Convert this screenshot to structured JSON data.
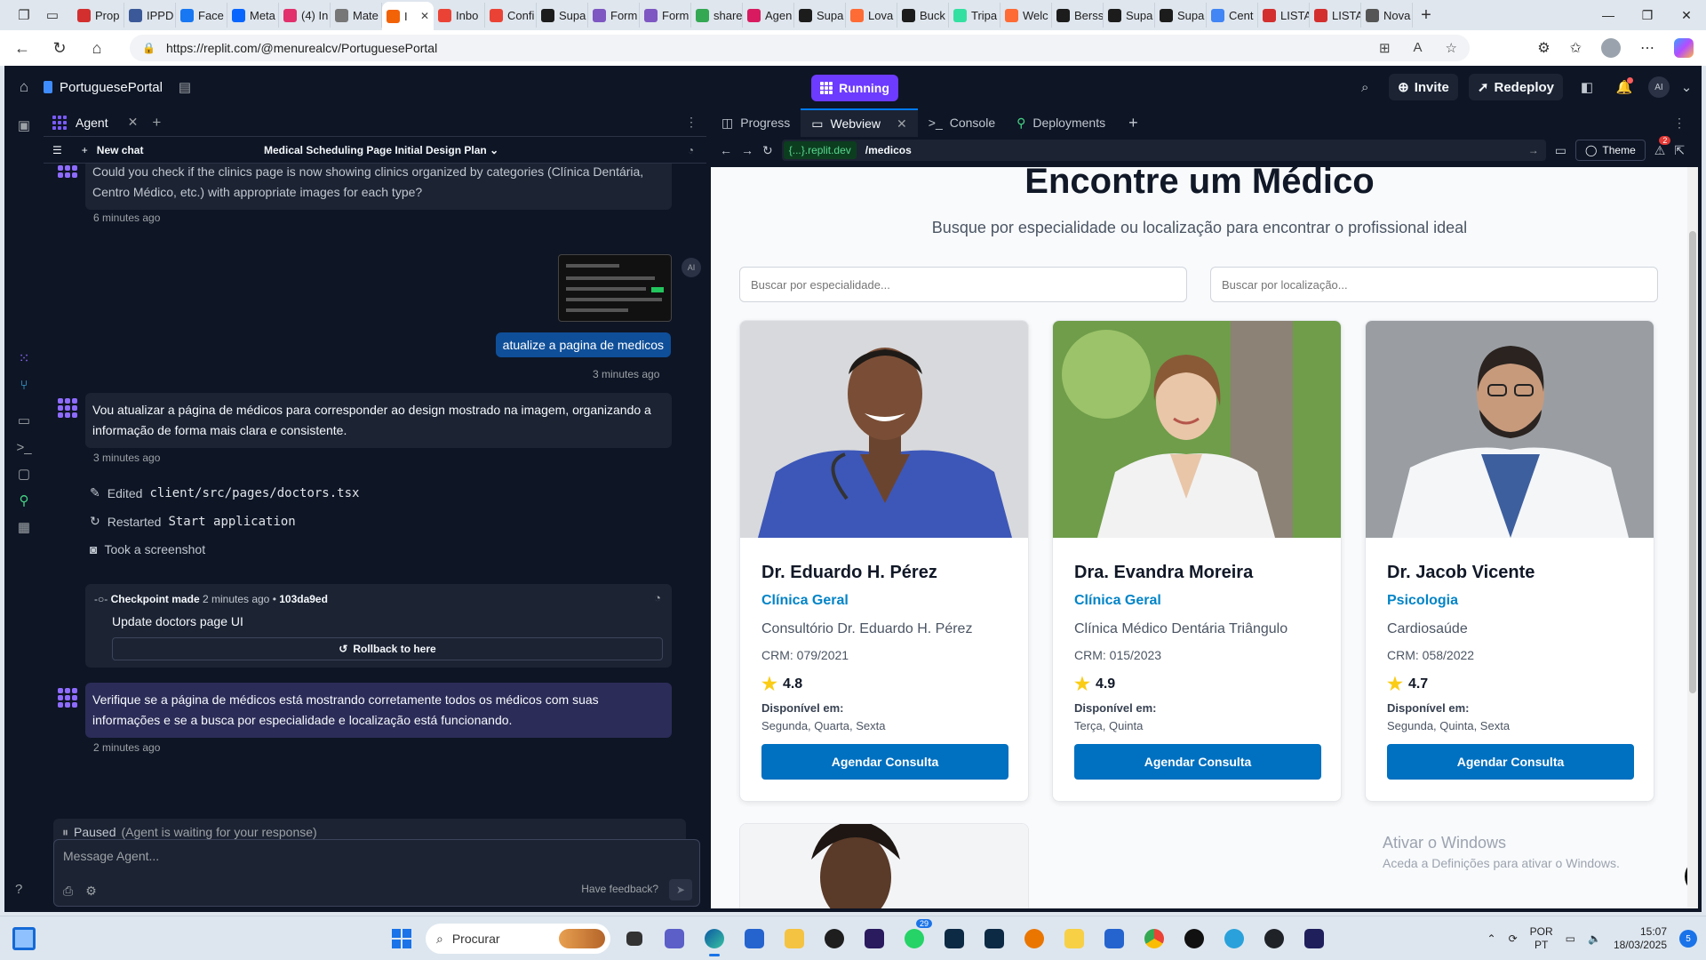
{
  "browser": {
    "tabs": [
      {
        "label": "Prop",
        "color": "#d32f2f"
      },
      {
        "label": "IPPD",
        "color": "#3b5998"
      },
      {
        "label": "Face",
        "color": "#1877f2"
      },
      {
        "label": "Meta",
        "color": "#0866ff"
      },
      {
        "label": "(4) In",
        "color": "#e1306c"
      },
      {
        "label": "Mate",
        "color": "#777777"
      },
      {
        "label": "I",
        "color": "#f26207",
        "active": true
      },
      {
        "label": "Inbo",
        "color": "#ea4335"
      },
      {
        "label": "Confi",
        "color": "#ea4335"
      },
      {
        "label": "Supa",
        "color": "#1c1c1c"
      },
      {
        "label": "Form",
        "color": "#7e57c2"
      },
      {
        "label": "Form",
        "color": "#7e57c2"
      },
      {
        "label": "share",
        "color": "#34a853"
      },
      {
        "label": "Agen",
        "color": "#d81b60"
      },
      {
        "label": "Supa",
        "color": "#1c1c1c"
      },
      {
        "label": "Lova",
        "color": "#ff6b35"
      },
      {
        "label": "Buck",
        "color": "#1c1c1c"
      },
      {
        "label": "Tripa",
        "color": "#34e0a1"
      },
      {
        "label": "Welc",
        "color": "#ff6b35"
      },
      {
        "label": "Berss",
        "color": "#1c1c1c"
      },
      {
        "label": "Supa",
        "color": "#1c1c1c"
      },
      {
        "label": "Supa",
        "color": "#1c1c1c"
      },
      {
        "label": "Cent",
        "color": "#4285f4"
      },
      {
        "label": "LISTA",
        "color": "#d32f2f"
      },
      {
        "label": "LISTA",
        "color": "#d32f2f"
      },
      {
        "label": "Nova",
        "color": "#555555"
      }
    ],
    "url": "https://replit.com/@menurealcv/PortuguesePortal"
  },
  "app": {
    "project_name": "PortuguesePortal",
    "status": "Running",
    "invite": "Invite",
    "redeploy": "Redeploy",
    "avatar": "AI"
  },
  "agent": {
    "tab_label": "Agent",
    "new_chat": "New chat",
    "plan_title": "Medical Scheduling Page Initial Design Plan",
    "messages": {
      "m1": "Could you check if the clinics page is now showing clinics organized by categories (Clínica Dentária, Centro Médico, etc.) with appropriate images for each type?",
      "m1_time": "6 minutes ago",
      "user_msg": "atualize a pagina de medicos",
      "user_time": "3 minutes ago",
      "user_avatar": "AI",
      "m2": "Vou atualizar a página de médicos para corresponder ao design mostrado na imagem, organizando a informação de forma mais clara e consistente.",
      "m2_time": "3 minutes ago",
      "act1_label": "Edited",
      "act1_code": "client/src/pages/doctors.tsx",
      "act2_label": "Restarted",
      "act2_code": "Start application",
      "act3_label": "Took a screenshot",
      "cp_prefix": "Checkpoint made",
      "cp_time": "2 minutes ago",
      "cp_hash": "103da9ed",
      "cp_title": "Update doctors page UI",
      "rollback": "Rollback to here",
      "m3": "Verifique se a página de médicos está mostrando corretamente todos os médicos com suas informações e se a busca por especialidade e localização está funcionando.",
      "m3_time": "2 minutes ago"
    },
    "paused_label": "Paused",
    "paused_detail": "(Agent is waiting for your response)",
    "composer_placeholder": "Message Agent...",
    "feedback": "Have feedback?"
  },
  "panel": {
    "tabs": [
      "Progress",
      "Webview",
      "Console",
      "Deployments"
    ],
    "domain": "{...}.replit.dev",
    "path": "/medicos",
    "theme": "Theme",
    "badge_count": "2"
  },
  "page": {
    "title": "Encontre um Médico",
    "subtitle": "Busque por especialidade ou localização para encontrar o profissional ideal",
    "search_specialty_placeholder": "Buscar por especialidade...",
    "search_location_placeholder": "Buscar por localização...",
    "available_label": "Disponível em:",
    "cta": "Agendar Consulta",
    "doctors": [
      {
        "name": "Dr. Eduardo H. Pérez",
        "specialty": "Clínica Geral",
        "clinic": "Consultório Dr. Eduardo H. Pérez",
        "crm": "CRM: 079/2021",
        "rating": "4.8",
        "days": "Segunda, Quarta, Sexta"
      },
      {
        "name": "Dra. Evandra Moreira",
        "specialty": "Clínica Geral",
        "clinic": "Clínica Médico Dentária Triângulo",
        "crm": "CRM: 015/2023",
        "rating": "4.9",
        "days": "Terça, Quinta"
      },
      {
        "name": "Dr. Jacob Vicente",
        "specialty": "Psicologia",
        "clinic": "Cardiosaúde",
        "crm": "CRM: 058/2022",
        "rating": "4.7",
        "days": "Segunda, Quinta, Sexta"
      }
    ],
    "activate_title": "Ativar o Windows",
    "activate_sub": "Aceda a Definições para ativar o Windows."
  },
  "taskbar": {
    "search": "Procurar",
    "whatsapp_badge": "29",
    "lang_1": "POR",
    "lang_2": "PT",
    "time": "15:07",
    "date": "18/03/2025",
    "notifications": "5"
  }
}
